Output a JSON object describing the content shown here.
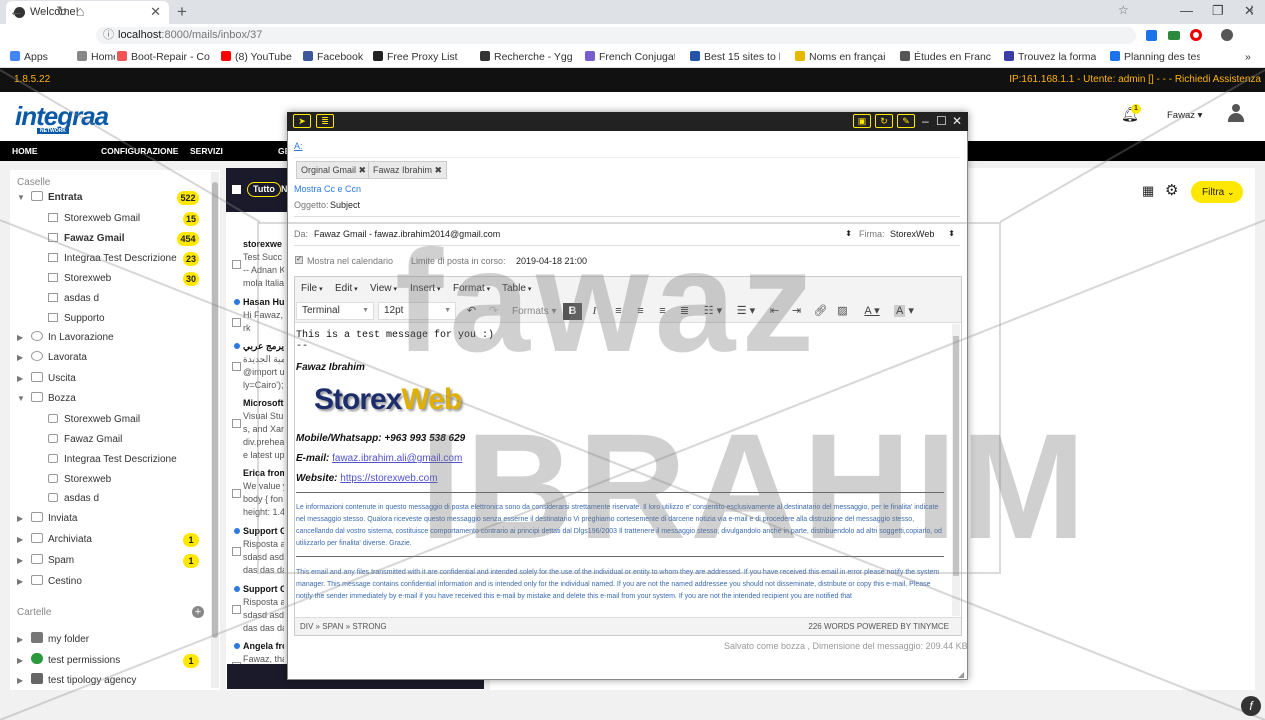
{
  "browser": {
    "tab_title": "Welcome!",
    "tab_close": "✕",
    "new_tab": "+",
    "url_scheme": "localhost",
    "url_path": ":8000/mails/inbox/37",
    "bookmarks": [
      "Apps",
      "Home",
      "Boot-Repair - Co",
      "(8) YouTube",
      "Facebook",
      "Free Proxy List -",
      "Recherche - Yggt",
      "French Conjugat",
      "Best 15 sites to l",
      "Noms en françai",
      "Études en Franc",
      "Trouvez la forma",
      "Planning des tes"
    ],
    "bookmark_colors": [
      "#4285f4",
      "#888",
      "#e55",
      "#f00",
      "#3b5998",
      "#222",
      "#333",
      "#7a5ccf",
      "#2255aa",
      "#e6b800",
      "#555",
      "#3a3aa8",
      "#1a73e8"
    ],
    "more": "»"
  },
  "app": {
    "version": "1.8.5.22",
    "ip_info": "IP:161.168.1.1 - Utente: admin [] - - - Richiedi Assistenza",
    "logo": "integraa",
    "logo_sub": "NETWORK",
    "bell_count": "1",
    "user_name": "Fawaz",
    "menu": [
      "HOME",
      "CONFIGURAZIONE",
      "SERVIZI",
      "GE"
    ]
  },
  "sidebar": {
    "caselle_title": "Caselle",
    "cartelle_title": "Cartelle",
    "entrata": {
      "label": "Entrata",
      "count": "522"
    },
    "entrata_items": [
      {
        "label": "Storexweb Gmail",
        "count": "15"
      },
      {
        "label": "Fawaz Gmail",
        "count": "454",
        "bold": true
      },
      {
        "label": "Integraa Test Descrizione",
        "count": "23"
      },
      {
        "label": "Storexweb",
        "count": "30"
      },
      {
        "label": "asdas d",
        "count": ""
      },
      {
        "label": "Supporto",
        "count": ""
      }
    ],
    "in_lavorazione": "In Lavorazione",
    "lavorata": "Lavorata",
    "uscita": "Uscita",
    "bozza": "Bozza",
    "bozza_items": [
      "Storexweb Gmail",
      "Fawaz Gmail",
      "Integraa Test Descrizione",
      "Storexweb",
      "asdas d"
    ],
    "inviata": "Inviata",
    "archiviata": {
      "label": "Archiviata",
      "count": "1"
    },
    "spam": {
      "label": "Spam",
      "count": "1"
    },
    "cestino": "Cestino",
    "folders": [
      {
        "label": "my folder",
        "count": ""
      },
      {
        "label": "test permissions",
        "count": "1"
      },
      {
        "label": "test tipology agency",
        "count": ""
      }
    ]
  },
  "maillist": {
    "tutto": "Tutto",
    "n": "N",
    "rows": [
      {
        "from": "storexwe",
        "lines": [
          "Test Succ",
          "-- Adnan K",
          "mola Italia"
        ],
        "unread": false
      },
      {
        "from": "Hasan Hu",
        "lines": [
          "Hi Fawaz,",
          "rk"
        ],
        "unread": true
      },
      {
        "from": "يرمج عربي",
        "lines": [
          "مية الجديدة",
          "@import u",
          "ly=Cairo');"
        ],
        "unread": true
      },
      {
        "from": "Microsoft",
        "lines": [
          "Visual Stu",
          "s, and Xan",
          "div.prehea",
          "e latest up"
        ],
        "unread": false
      },
      {
        "from": "Erica from",
        "lines": [
          "We value y",
          "body { fon",
          "height: 1.4"
        ],
        "unread": false
      },
      {
        "from": "Support G",
        "lines": [
          "Risposta a",
          "sdasd asd",
          "das das da"
        ],
        "unread": true
      },
      {
        "from": "Support G",
        "lines": [
          "Risposta a",
          "sdasd asd",
          "das das da"
        ],
        "unread": true
      },
      {
        "from": "Angela fro",
        "lines": [
          "Fawaz, tha"
        ],
        "unread": true
      }
    ]
  },
  "toolbar_right": {
    "filtra": "Filtra"
  },
  "compose": {
    "to_label": "A:",
    "chips": [
      "Orginal Gmail ✖",
      "Fawaz Ibrahim ✖"
    ],
    "cc_link": "Mostra Cc e Ccn",
    "subject_label": "Oggetto:",
    "subject_value": "Subject",
    "from_label": "Da:",
    "from_value": "Fawaz Gmail - fawaz.ibrahim2014@gmail.com",
    "firma_label": "Firma:",
    "firma_value": "StorexWeb",
    "calendar_label": "Mostra nel calendario",
    "deadline_label": "Limite di posta in corso:",
    "deadline_value": "2019-04-18 21:00",
    "saved_info": "Salvato come bozza , Dimensione del messaggio: 209.44 KB"
  },
  "editor": {
    "menus": [
      "File",
      "Edit",
      "View",
      "Insert",
      "Format",
      "Table"
    ],
    "font": "Terminal",
    "size": "12pt",
    "formats": "Formats",
    "body_line": "This is a test message for you :)",
    "sig_dashes": "--",
    "sig_name": "Fawaz Ibrahim",
    "sig_logo_a": "Storex",
    "sig_logo_b": "Web",
    "mobile": "Mobile/Whatsapp: +963 993 538 629",
    "email_label": "E-mail:",
    "email_value": "fawaz.ibrahim.ali@gmail.com",
    "website_label": "Website:",
    "website_value": "https://storexweb.com",
    "disclaimer_it": "Le informazioni contenute in questo messaggio di posta elettronica sono da considerarsi strettamente riservate. Il loro utilizzo e' consentito esclusivamente al destinatario del messaggio, per le finalita' indicate nel messaggio stesso. Qualora riceveste questo messaggio senza esserne il destinatario Vi preghiamo cortesemente di darcene notizia via e-mail e di procedere alla distruzione del messaggio stesso, cancellando dal vostro sistema, costituisce comportamento contrario ai principi dettati dal Dlgs196/2003 Il trattenere il messaggio stesso, divulgandolo anche in parte, distribuendolo ad altri soggetti,copiarlo, od utilizzarlo per finalita' diverse. Grazie.",
    "disclaimer_en": "This email and any files transmitted with it are confidential and intended solely for the use of the individual or entity to whom they are addressed. If you have received this email in error please notify the system manager. This message contains confidential information and is intended only for the individual named. If you are not the named addressee you should not disseminate, distribute or copy this e-mail. Please notify the sender immediately by e-mail if you have received this e-mail by mistake and delete this e-mail from your system. If you are not the intended recipient you are notified that",
    "path": "DIV » SPAN » STRONG",
    "words": "226 WORDS POWERED BY TINYMCE"
  },
  "watermark": {
    "line1": "fawaz",
    "line2": "IBRAHIM"
  },
  "colors": {
    "accent": "#ffe700",
    "dark": "#111111",
    "link": "#2a7ae2"
  }
}
